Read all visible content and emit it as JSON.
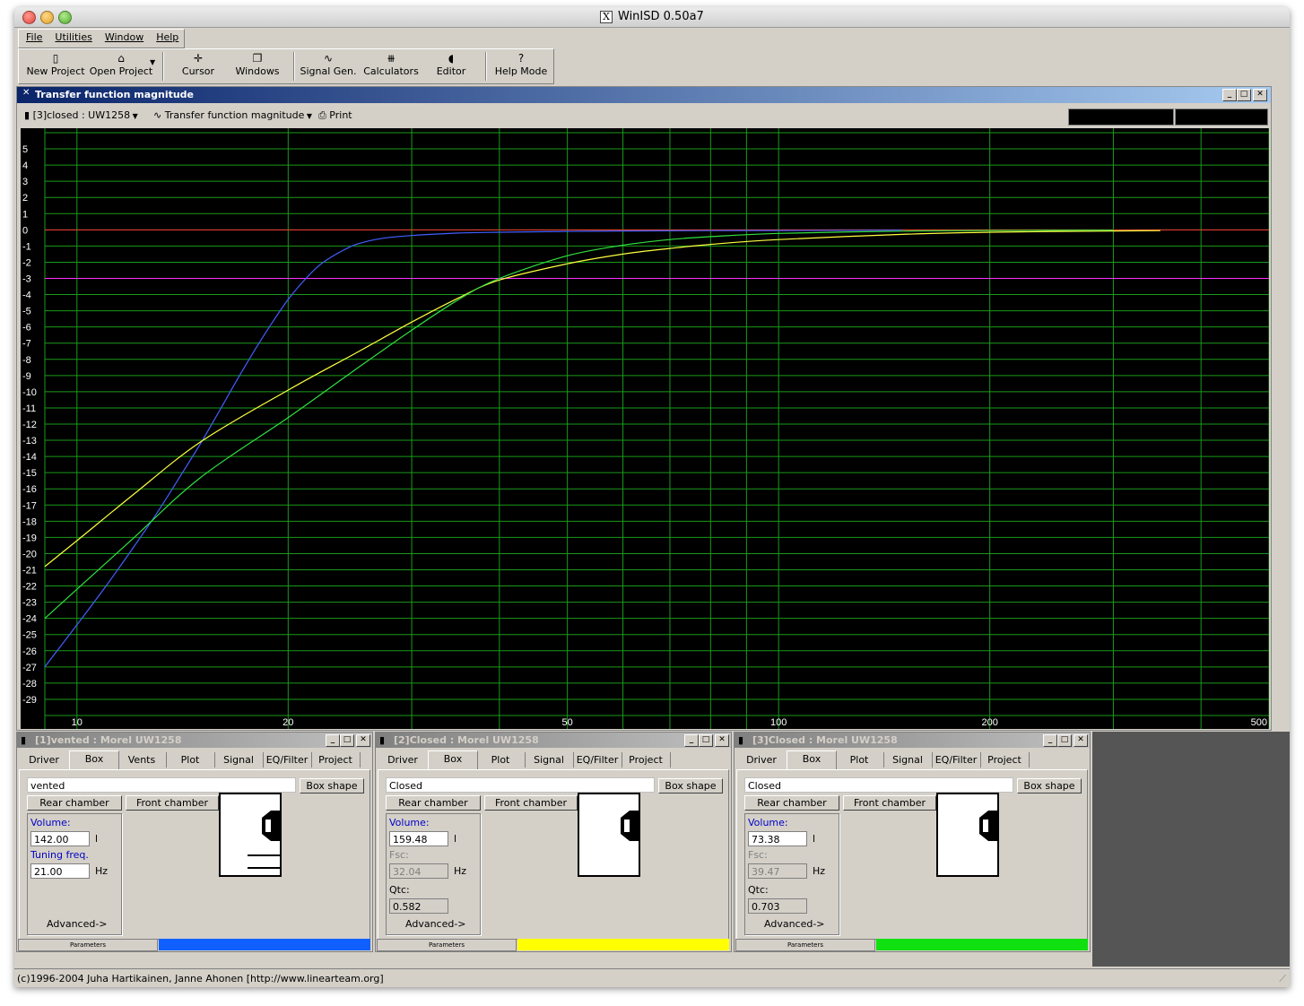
{
  "app": {
    "title": "WinISD 0.50a7"
  },
  "menu": {
    "items": [
      "File",
      "Utilities",
      "Window",
      "Help"
    ]
  },
  "toolbar": {
    "new_project": "New Project",
    "open_project": "Open Project",
    "cursor": "Cursor",
    "windows": "Windows",
    "signal_gen": "Signal Gen.",
    "calculators": "Calculators",
    "editor": "Editor",
    "help_mode": "Help Mode"
  },
  "plot_window": {
    "title": "Transfer function magnitude",
    "project_select": "[3]closed : UW1258",
    "plot_type_select": "Transfer function magnitude",
    "print_label": "Print"
  },
  "chart_data": {
    "type": "line",
    "title": "Transfer function magnitude",
    "x_scale": "log",
    "xlim": [
      9,
      500
    ],
    "ylim": [
      -30,
      6
    ],
    "x_tick_labels": [
      "10",
      "20",
      "50",
      "100",
      "200",
      "500"
    ],
    "y_tick_labels": [
      "5",
      "4",
      "3",
      "2",
      "1",
      "0",
      "-1",
      "-2",
      "-3",
      "-4",
      "-5",
      "-6",
      "-7",
      "-8",
      "-9",
      "-10",
      "-11",
      "-12",
      "-13",
      "-14",
      "-15",
      "-16",
      "-17",
      "-18",
      "-19",
      "-20",
      "-21",
      "-22",
      "-23",
      "-24",
      "-25",
      "-26",
      "-27",
      "-28",
      "-29"
    ],
    "grid": true,
    "reference_lines": [
      {
        "y": 0,
        "color": "#ff3030"
      },
      {
        "y": -3,
        "color": "#ff30ff"
      }
    ],
    "series": [
      {
        "color": "#4060ff",
        "x": [
          9,
          10,
          11,
          12,
          13,
          14,
          15,
          16,
          17,
          18,
          19,
          20,
          21,
          22,
          23,
          24,
          25,
          27,
          30,
          35,
          40,
          50,
          60,
          80,
          100,
          150
        ],
        "y": [
          -27,
          -24.4,
          -22,
          -19.7,
          -17.5,
          -15.3,
          -13.2,
          -11.1,
          -9.1,
          -7.3,
          -5.7,
          -4.3,
          -3.2,
          -2.3,
          -1.7,
          -1.25,
          -0.9,
          -0.55,
          -0.35,
          -0.2,
          -0.15,
          -0.1,
          -0.07,
          -0.05,
          -0.04,
          -0.02
        ]
      },
      {
        "color": "#ffff40",
        "x": [
          9,
          10,
          12,
          15,
          20,
          25,
          30,
          35,
          40,
          50,
          60,
          70,
          80,
          100,
          150,
          200,
          300,
          350
        ],
        "y": [
          -20.8,
          -19.2,
          -16.4,
          -13.1,
          -9.9,
          -7.6,
          -5.7,
          -4.2,
          -3.1,
          -2.1,
          -1.5,
          -1.15,
          -0.9,
          -0.6,
          -0.28,
          -0.15,
          -0.07,
          -0.05
        ]
      },
      {
        "color": "#30e040",
        "x": [
          9,
          10,
          12,
          15,
          20,
          25,
          30,
          35,
          40,
          50,
          60,
          70,
          80,
          100,
          150,
          200,
          300
        ],
        "y": [
          -24,
          -22.2,
          -19.1,
          -15.3,
          -11.6,
          -8.6,
          -6.2,
          -4.3,
          -3.0,
          -1.6,
          -0.95,
          -0.6,
          -0.42,
          -0.22,
          -0.08,
          -0.04,
          -0.02
        ]
      }
    ]
  },
  "param_windows": [
    {
      "title": "[1]vented : Morel UW1258",
      "tabs": [
        "Driver",
        "Box",
        "Vents",
        "Plot",
        "Signal",
        "EQ/Filter",
        "Project"
      ],
      "box_type": "vented",
      "box_shape_btn": "Box shape",
      "rear_chamber_btn": "Rear chamber",
      "front_chamber_btn": "Front chamber",
      "field1_label": "Volume:",
      "field1_value": "142.00",
      "field1_unit": "l",
      "field2_label": "Tuning freq.",
      "field2_value": "21.00",
      "field2_unit": "Hz",
      "advanced": "Advanced->",
      "status_label": "Parameters",
      "color": "#1060ff"
    },
    {
      "title": "[2]Closed : Morel UW1258",
      "tabs": [
        "Driver",
        "Box",
        "Plot",
        "Signal",
        "EQ/Filter",
        "Project"
      ],
      "box_type": "Closed",
      "box_shape_btn": "Box shape",
      "rear_chamber_btn": "Rear chamber",
      "front_chamber_btn": "Front chamber",
      "field1_label": "Volume:",
      "field1_value": "159.48",
      "field1_unit": "l",
      "field2_label": "Fsc:",
      "field2_value": "32.04",
      "field2_unit": "Hz",
      "qtc_label": "Qtc:",
      "qtc_value": "0.582",
      "advanced": "Advanced->",
      "status_label": "Parameters",
      "color": "#ffff00"
    },
    {
      "title": "[3]Closed : Morel UW1258",
      "tabs": [
        "Driver",
        "Box",
        "Plot",
        "Signal",
        "EQ/Filter",
        "Project"
      ],
      "box_type": "Closed",
      "box_shape_btn": "Box shape",
      "rear_chamber_btn": "Rear chamber",
      "front_chamber_btn": "Front chamber",
      "field1_label": "Volume:",
      "field1_value": "73.38",
      "field1_unit": "l",
      "field2_label": "Fsc:",
      "field2_value": "39.47",
      "field2_unit": "Hz",
      "qtc_label": "Qtc:",
      "qtc_value": "0.703",
      "advanced": "Advanced->",
      "status_label": "Parameters",
      "color": "#10e010"
    }
  ],
  "status_bar": {
    "text": "(c)1996-2004 Juha Hartikainen, Janne Ahonen [http://www.linearteam.org]"
  }
}
